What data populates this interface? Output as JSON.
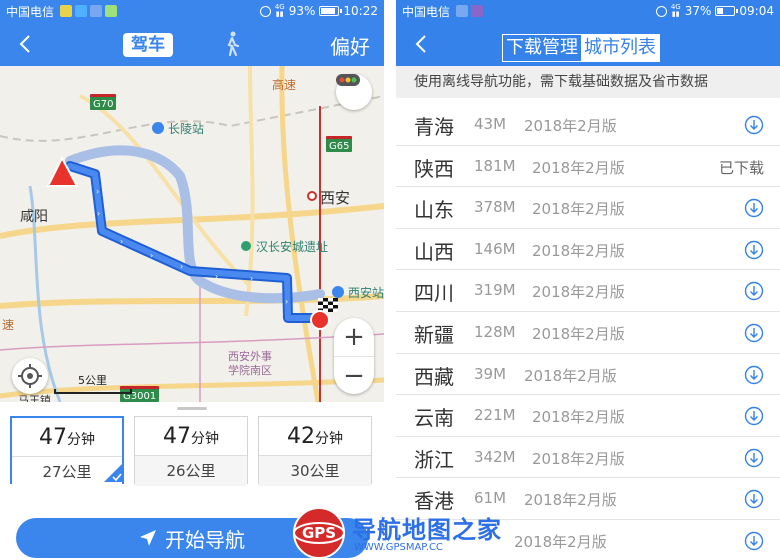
{
  "left": {
    "status": {
      "carrier": "中国电信",
      "battery": "93%",
      "battery_level": 0.93,
      "time": "10:22",
      "net": "4G"
    },
    "header": {
      "mode_drive": "驾车",
      "walk_icon": "walk-icon",
      "preference": "偏好"
    },
    "map": {
      "places": [
        "长陵站",
        "西安",
        "咸阳",
        "汉长安城遗址",
        "西安站",
        "西安外事学院南区",
        "马王镇"
      ],
      "school_lines": [
        "西安外事",
        "学院南区"
      ],
      "roads": [
        "高速",
        "速"
      ],
      "road_shields": [
        "G70",
        "G65",
        "G3001"
      ],
      "scale": "5公里",
      "zoom_in": "+",
      "zoom_out": "−"
    },
    "routes": [
      {
        "time": "47",
        "unit": "分钟",
        "distance": "27公里",
        "selected": true
      },
      {
        "time": "47",
        "unit": "分钟",
        "distance": "26公里",
        "selected": false
      },
      {
        "time": "42",
        "unit": "分钟",
        "distance": "30公里",
        "selected": false
      }
    ],
    "start_button": "开始导航"
  },
  "right": {
    "status": {
      "carrier": "中国电信",
      "battery": "37%",
      "battery_level": 0.37,
      "time": "09:04",
      "net": "4G"
    },
    "tabs": [
      "下载管理",
      "城市列表"
    ],
    "active_tab": 1,
    "hint": "使用离线导航功能，需下载基础数据及省市数据",
    "provinces": [
      {
        "name": "青海",
        "size": "43M",
        "version": "2018年2月版",
        "status": "download"
      },
      {
        "name": "陕西",
        "size": "181M",
        "version": "2018年2月版",
        "status": "已下载"
      },
      {
        "name": "山东",
        "size": "378M",
        "version": "2018年2月版",
        "status": "download"
      },
      {
        "name": "山西",
        "size": "146M",
        "version": "2018年2月版",
        "status": "download"
      },
      {
        "name": "四川",
        "size": "319M",
        "version": "2018年2月版",
        "status": "download"
      },
      {
        "name": "新疆",
        "size": "128M",
        "version": "2018年2月版",
        "status": "download"
      },
      {
        "name": "西藏",
        "size": "39M",
        "version": "2018年2月版",
        "status": "download"
      },
      {
        "name": "云南",
        "size": "221M",
        "version": "2018年2月版",
        "status": "download"
      },
      {
        "name": "浙江",
        "size": "342M",
        "version": "2018年2月版",
        "status": "download"
      },
      {
        "name": "香港",
        "size": "61M",
        "version": "2018年2月版",
        "status": "download"
      },
      {
        "name": "",
        "size": "",
        "version": "2018年2月版",
        "status": "download"
      }
    ]
  },
  "watermark": {
    "logo_text": "GPS",
    "title": "导航地图之家",
    "url": "WWW.GPSMAP.CC"
  },
  "colors": {
    "primary": "#3a86ec",
    "route": "#3f7be0",
    "alt_route": "#a9bfe6",
    "gps_red": "#d42a2a"
  }
}
